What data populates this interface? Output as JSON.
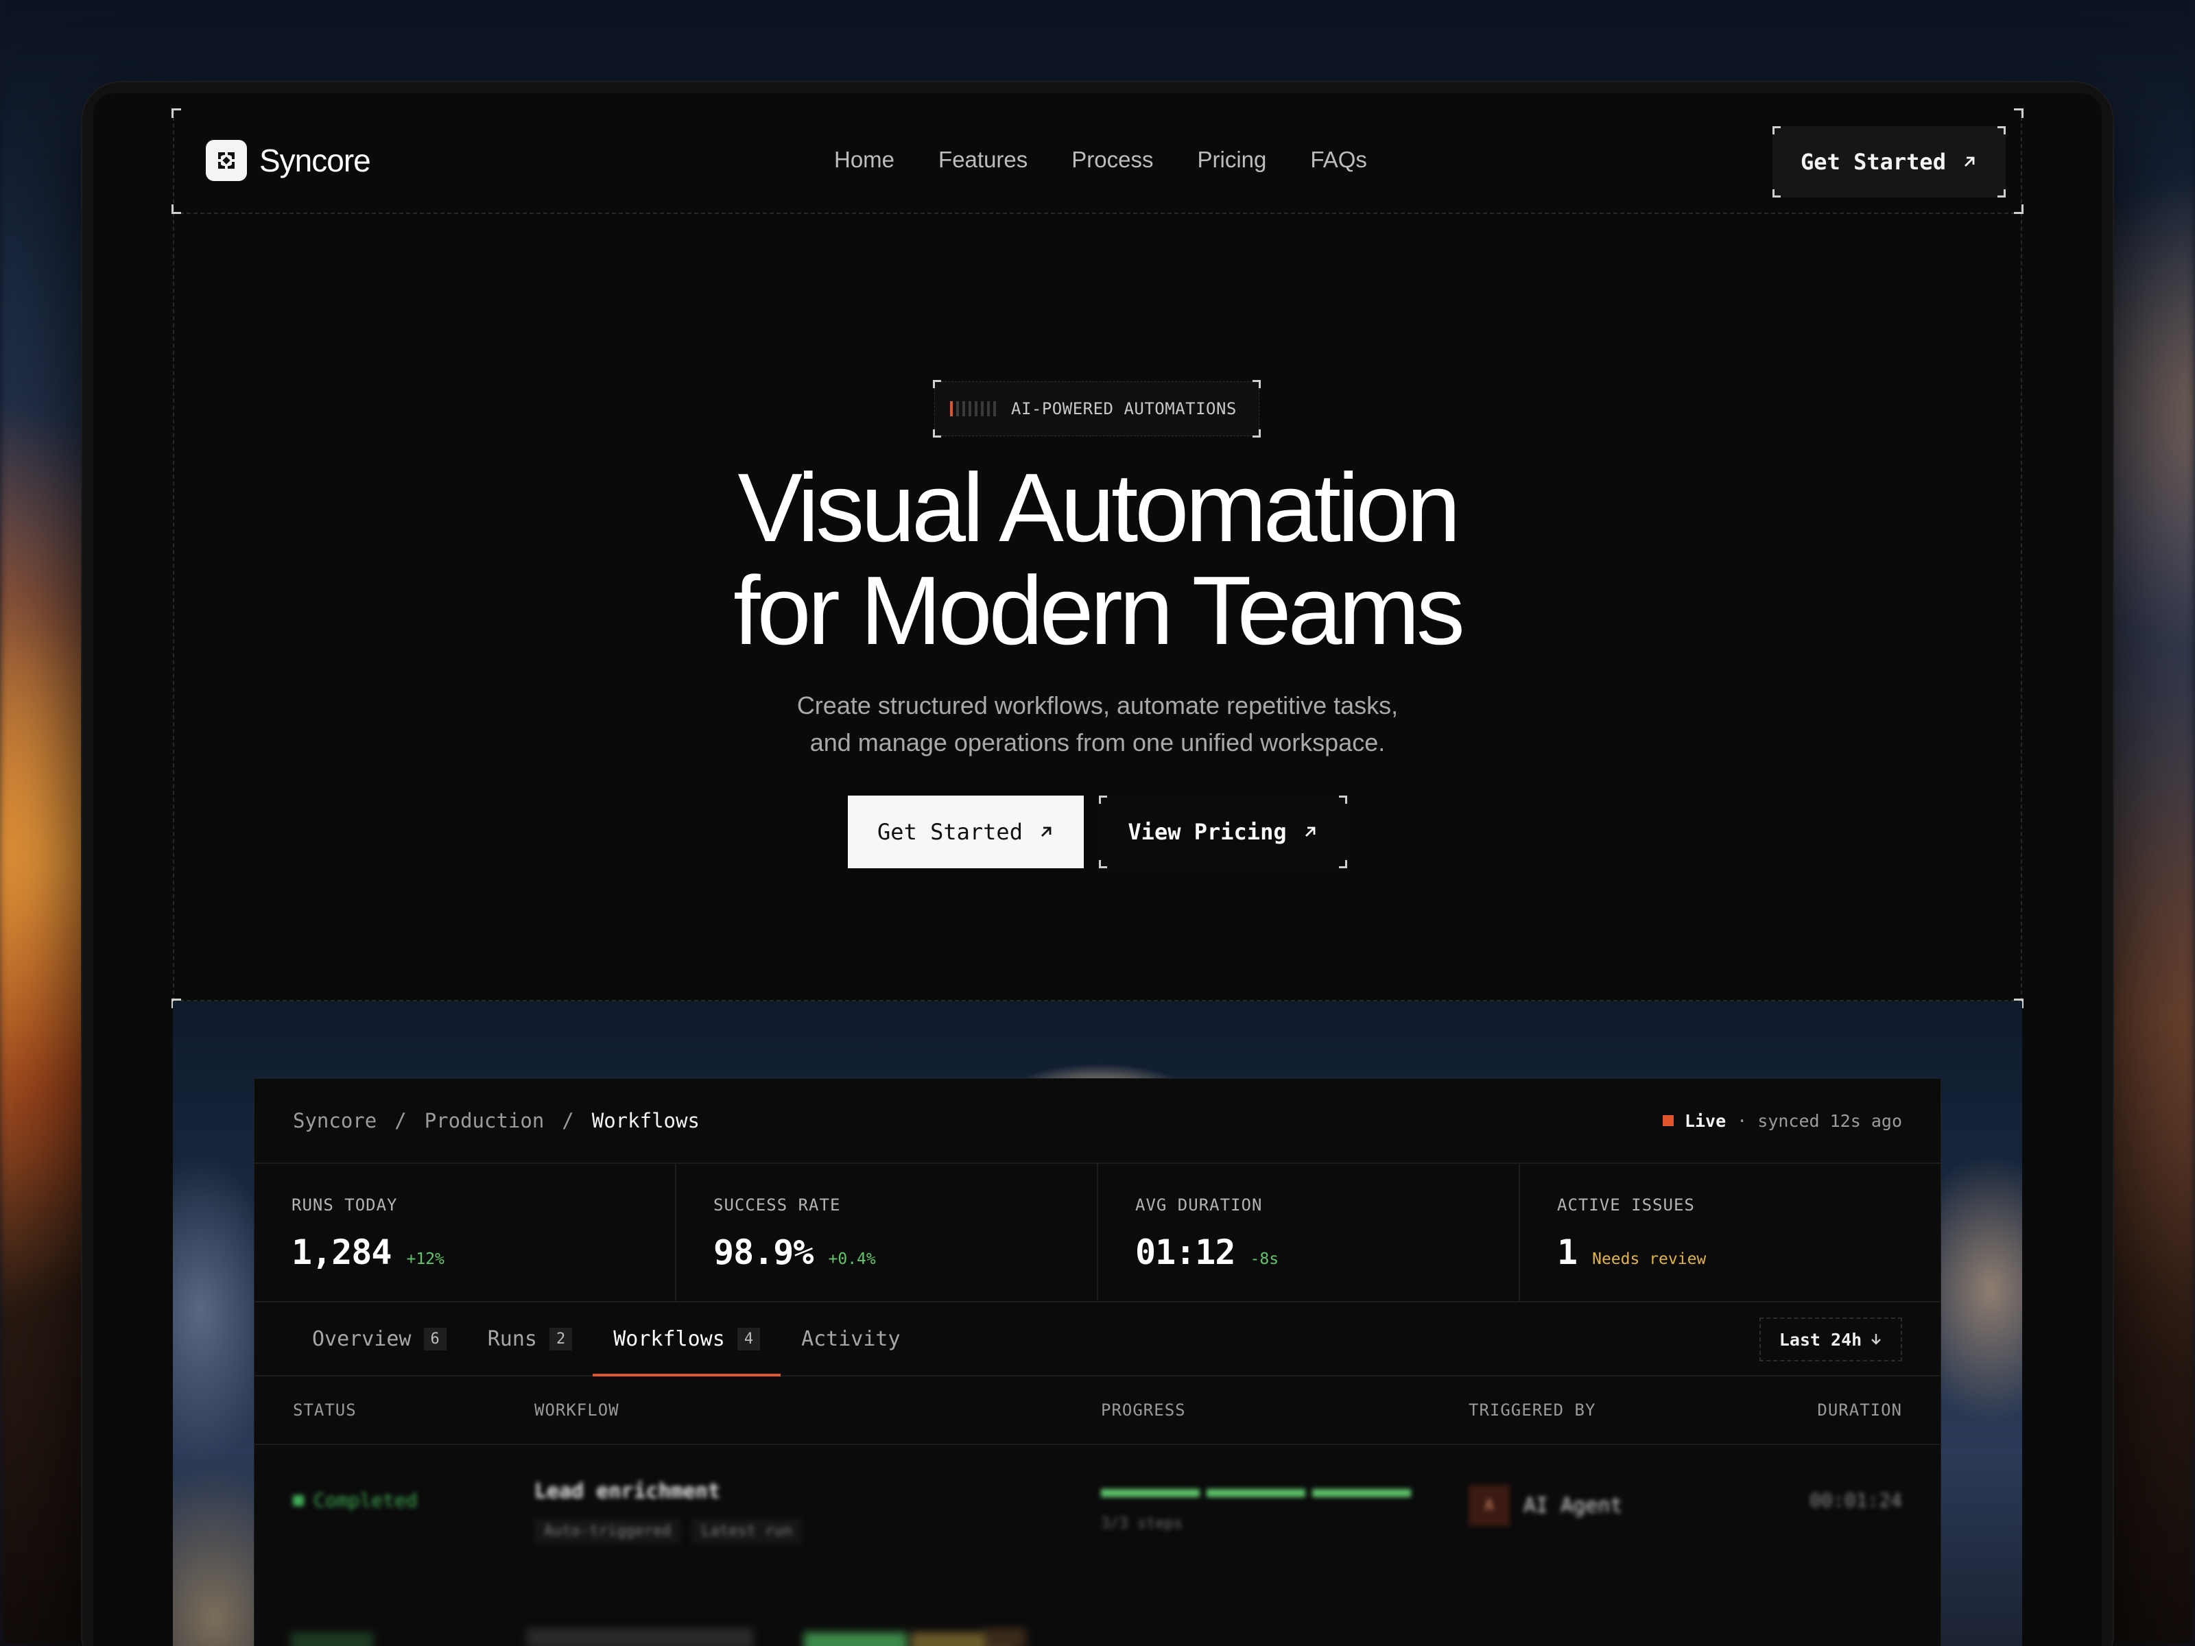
{
  "brand": {
    "name": "Syncore"
  },
  "nav": {
    "items": [
      "Home",
      "Features",
      "Process",
      "Pricing",
      "FAQs"
    ],
    "cta_label": "Get Started"
  },
  "hero": {
    "badge": "AI-POWERED AUTOMATIONS",
    "title_line1": "Visual Automation",
    "title_line2": "for Modern Teams",
    "subtitle_line1": "Create structured workflows, automate repetitive tasks,",
    "subtitle_line2": "and manage operations from one unified workspace.",
    "primary_cta": "Get Started",
    "secondary_cta": "View Pricing"
  },
  "dashboard": {
    "breadcrumb": [
      "Syncore",
      "/",
      "Production",
      "/",
      "Workflows"
    ],
    "live_label": "Live",
    "sync_text": "· synced 12s ago",
    "stats": [
      {
        "label": "RUNS TODAY",
        "value": "1,284",
        "delta": "+12%"
      },
      {
        "label": "SUCCESS RATE",
        "value": "98.9%",
        "delta": "+0.4%"
      },
      {
        "label": "AVG DURATION",
        "value": "01:12",
        "delta": "-8s"
      },
      {
        "label": "ACTIVE ISSUES",
        "value": "1",
        "delta": "Needs review"
      }
    ],
    "tabs": [
      {
        "label": "Overview",
        "count": "6"
      },
      {
        "label": "Runs",
        "count": "2"
      },
      {
        "label": "Workflows",
        "count": "4"
      },
      {
        "label": "Activity",
        "count": ""
      }
    ],
    "range_label": "Last 24h",
    "columns": [
      "STATUS",
      "WORKFLOW",
      "PROGRESS",
      "TRIGGERED BY",
      "DURATION"
    ],
    "rows": [
      {
        "status": "Completed",
        "workflow": "Lead enrichment",
        "tags": [
          "Auto-triggered",
          "Latest run"
        ],
        "progress_text": "3/3 steps",
        "triggered_initial": "A",
        "triggered_by": "AI Agent",
        "duration": "00:01:24"
      }
    ]
  },
  "colors": {
    "accent": "#e0552b",
    "success": "#5fc76a",
    "warning": "#e0b44a",
    "background": "#0a0a0a"
  }
}
